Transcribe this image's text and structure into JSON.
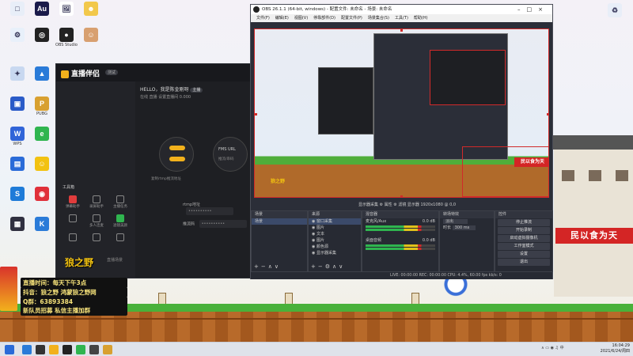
{
  "desktop": {
    "icons": [
      {
        "label": "",
        "color": "#e8eef8",
        "glyph": "□"
      },
      {
        "label": "",
        "color": "#1a1a4a",
        "glyph": "Au"
      },
      {
        "label": "",
        "color": "#ffffff",
        "glyph": "🖼"
      },
      {
        "label": "",
        "color": "#f2c84b",
        "glyph": "☻"
      },
      {
        "label": "",
        "color": "#e8f0fa",
        "glyph": "⚙"
      },
      {
        "label": "",
        "color": "#222222",
        "glyph": "◎"
      },
      {
        "label": "OBS Studio",
        "color": "#222222",
        "glyph": "●"
      },
      {
        "label": "",
        "color": "#d8a070",
        "glyph": "☺"
      },
      {
        "label": "",
        "color": "#c8d8f0",
        "glyph": "✦"
      },
      {
        "label": "",
        "color": "#2a7bd8",
        "glyph": "▲"
      },
      {
        "label": "",
        "color": "#2a5bc8",
        "glyph": "▣"
      },
      {
        "label": "PUBG",
        "color": "#d8a030",
        "glyph": "P"
      },
      {
        "label": "WPS",
        "color": "#3064d8",
        "glyph": "W"
      },
      {
        "label": "",
        "color": "#2fb54f",
        "glyph": "e"
      },
      {
        "label": "",
        "color": "#2a6bd8",
        "glyph": "▤"
      },
      {
        "label": "",
        "color": "#f2c211",
        "glyph": "☺"
      },
      {
        "label": "",
        "color": "#1e7bd8",
        "glyph": "S"
      },
      {
        "label": "",
        "color": "#e0303a",
        "glyph": "◉"
      },
      {
        "label": "",
        "color": "#303040",
        "glyph": "▦"
      },
      {
        "label": "",
        "color": "#2a7bd8",
        "glyph": "K"
      }
    ],
    "recycle_label": "",
    "banner_text": "民以食为天"
  },
  "streamer_app": {
    "logo": "直播伴侣",
    "version": "测试",
    "hello": "HELLO，我是陈金刚呀",
    "badge": "主播",
    "tabs_row": "在线  直播  设置直播间   0.000",
    "nav": [
      "",
      "",
      ""
    ],
    "section": "工具箱",
    "tools": [
      {
        "label": "弹幕助手",
        "style": "hot"
      },
      {
        "label": "录屏助手",
        "style": ""
      },
      {
        "label": "主播任务",
        "style": ""
      },
      {
        "label": "",
        "style": ""
      },
      {
        "label": "多人连麦",
        "style": ""
      },
      {
        "label": "滤镜美颜",
        "style": "hot2"
      },
      {
        "label": "",
        "style": ""
      },
      {
        "label": "",
        "style": ""
      },
      {
        "label": "",
        "style": ""
      }
    ],
    "circle_left_pills": [
      "直播",
      "开播"
    ],
    "circle_left_label": "复制rtmp推流地址",
    "circle_right_label": "FMS URL",
    "circle_right_sub": "推流/串码",
    "rtmp_label": "rtmp地址",
    "rtmp_value": "••••••••••",
    "key_label": "推流码",
    "key_value": "••••••••••",
    "bottom": [
      "直播场景",
      "",
      ""
    ]
  },
  "overlay": {
    "title": "狼之野",
    "lines": [
      "直播时间：每天下午3点",
      "抖音：狼之野 鸿蒙狼之野网",
      "Q群：63893384",
      "新队员招募 私信主播加群"
    ]
  },
  "obs": {
    "title": "OBS 26.1.1 (64-bit, windows) - 配置文件: 未命名 - 场景: 未命名",
    "menus": [
      "文件(F)",
      "编辑(E)",
      "视图(V)",
      "停靠部件(D)",
      "配置文件(P)",
      "场景集合(S)",
      "工具(T)",
      "帮助(H)"
    ],
    "preview_banner": "民以食为天",
    "preview_title": "狼之野",
    "source_bar": "显示器采集      ⚙ 属性   ⚙ 滤镜   显示器   1920x1080 @ 0,0",
    "scenes_title": "场景",
    "scenes": [
      "场景"
    ],
    "sources_title": "来源",
    "sources": [
      "窗口采集",
      "图片",
      "文本",
      "图片",
      "颜色源",
      "显示器采集"
    ],
    "mixer_title": "混音器",
    "mixer": [
      {
        "name": "麦克风/Aux",
        "level": "0.0 dB"
      },
      {
        "name": "桌面音频",
        "level": "0.0 dB"
      }
    ],
    "transitions_title": "转场特效",
    "transition_value": "淡出",
    "duration_label": "时长",
    "duration_value": "300 ms",
    "controls_title": "控件",
    "controls": [
      "停止推流",
      "开始录制",
      "启动虚拟摄像机",
      "工作室模式",
      "设置",
      "退出"
    ],
    "status": "LIVE: 00:00:00   REC: 00:00:00   CPU: 4.4%, 60.00 fps   kb/s: 0"
  },
  "taskbar": {
    "time": "16:04:29",
    "date": "2021/6/24/周四",
    "icons": [
      "#2a7bd8",
      "#333",
      "#f2b11c",
      "#222",
      "#2fb54f",
      "#444",
      "#d8a030"
    ]
  },
  "colors": {
    "accent_red": "#d12a2a",
    "brand_yellow": "#f2b11c",
    "obs_bg": "#2b2e38",
    "app_bg": "#1e1f23"
  }
}
